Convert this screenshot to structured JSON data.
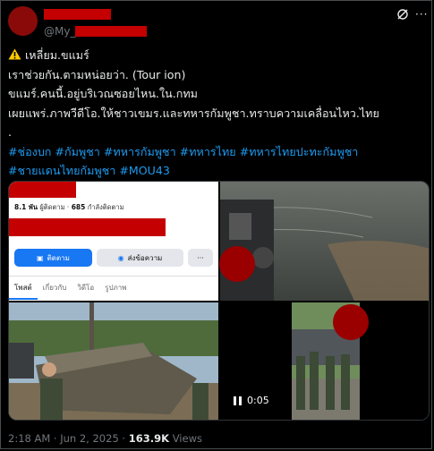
{
  "tweet": {
    "handle": "@My_",
    "lines": [
      "เหลี่ยม.ขแมร์",
      "เราช่วยกัน.ตามหน่อยว่า. (Tour ion)",
      "ขแมร์.คนนี้.อยู่บริเวณซอยไหน.ใน.กทม",
      "เผยแพร่.ภาพวีดีโอ.ให้ชาวเขมร.และทหารกัมพูชา.ทราบความเคลื่อนไหว.ไทย",
      "."
    ],
    "hashtags": [
      "#ช่องบก #กัมพูชา #ทหารกัมพูชา #ทหารไทย #ทหารไทยปะทะกัมพูชา",
      "#ชายแดนไทยกัมพูชา #MOU43"
    ],
    "timestamp": "2:18 AM · Jun 2, 2025 · ",
    "views_count": "163.9K",
    "views_label": "Views"
  },
  "facebook_card": {
    "followers_count": "8.1 พัน",
    "followers_label": "ผู้ติดตาม",
    "following_count": "685",
    "following_label": "กำลังติดตาม",
    "follow_button": "ติดตาม",
    "message_button": "ส่งข้อความ",
    "more_button": "···",
    "tabs": [
      "โพสต์",
      "เกี่ยวกับ",
      "วิดีโอ",
      "รูปภาพ"
    ]
  },
  "video": {
    "time": "0:05"
  },
  "colors": {
    "background": "#000000",
    "text": "#e7e9ea",
    "muted": "#71767b",
    "link": "#1d9bf0",
    "redaction": "#c40000",
    "fb_blue": "#1877f2"
  }
}
